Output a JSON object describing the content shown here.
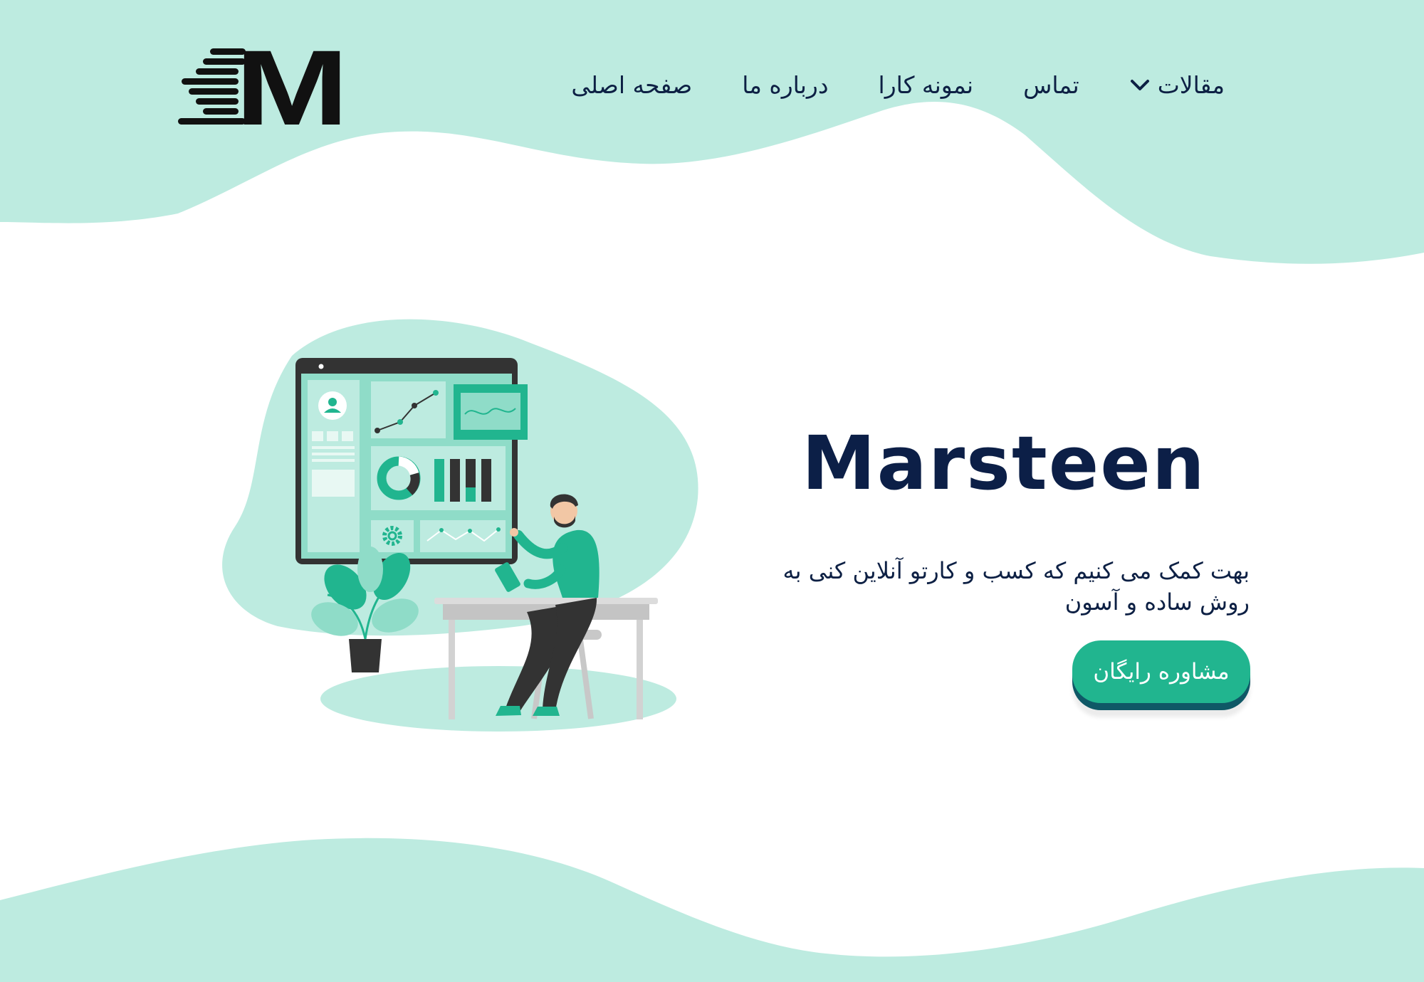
{
  "colors": {
    "mint_background": "#bdebe0",
    "accent_green": "#21b58f",
    "navy_text": "#0c1f47",
    "button_shadow": "#0f5866"
  },
  "header": {
    "logo_letter": "M",
    "nav": [
      {
        "label": "صفحه اصلی"
      },
      {
        "label": "درباره ما"
      },
      {
        "label": "نمونه کارا"
      },
      {
        "label": "تماس"
      },
      {
        "label": "مقالات",
        "has_dropdown": true,
        "icon": "chevron-down-icon"
      }
    ]
  },
  "hero": {
    "title": "Marsteen",
    "description": "بهت کمک می کنیم که کسب و کارتو آنلاین کنی به روش ساده و آسون",
    "cta_label": "مشاوره رایگان"
  },
  "illustration": {
    "icon": "analytics-dashboard-illustration"
  }
}
